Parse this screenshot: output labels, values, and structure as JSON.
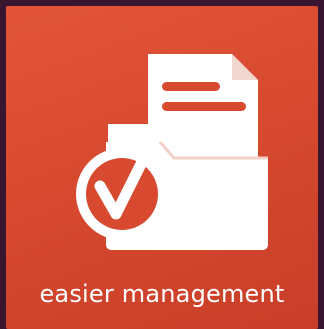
{
  "tile": {
    "label": "easier management",
    "icon": "folder-document-check-icon",
    "colors": {
      "background_dark": "#3a1530",
      "tile_top": "#e2553a",
      "tile_bottom": "#c83e28",
      "icon": "#ffffff",
      "label": "#ffffff"
    }
  }
}
